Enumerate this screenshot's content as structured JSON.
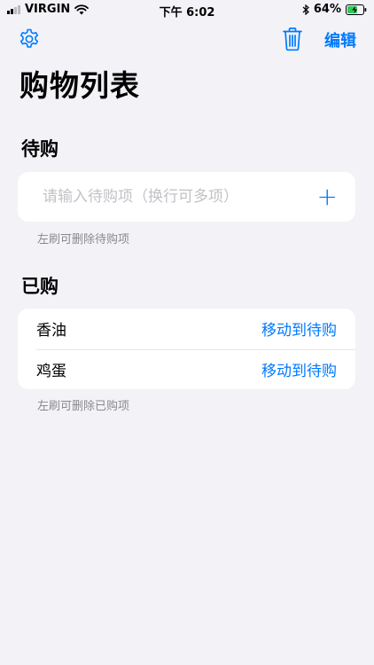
{
  "status_bar": {
    "carrier": "VIRGIN",
    "time": "下午 6:02",
    "battery": "64%",
    "battery_level": 0.64
  },
  "nav": {
    "settings_icon": "gear-icon",
    "trash_icon": "trash-icon",
    "edit_label": "编辑"
  },
  "page_title": "购物列表",
  "to_buy": {
    "header": "待购",
    "input_placeholder": "请输入待购项（换行可多项）",
    "add_icon": "+",
    "footer": "左刷可删除待购项"
  },
  "bought": {
    "header": "已购",
    "items": [
      {
        "name": "香油",
        "action": "移动到待购"
      },
      {
        "name": "鸡蛋",
        "action": "移动到待购"
      }
    ],
    "footer": "左刷可删除已购项"
  },
  "colors": {
    "accent": "#007aff",
    "background": "#f2f2f7",
    "battery_fill": "#34c759"
  }
}
